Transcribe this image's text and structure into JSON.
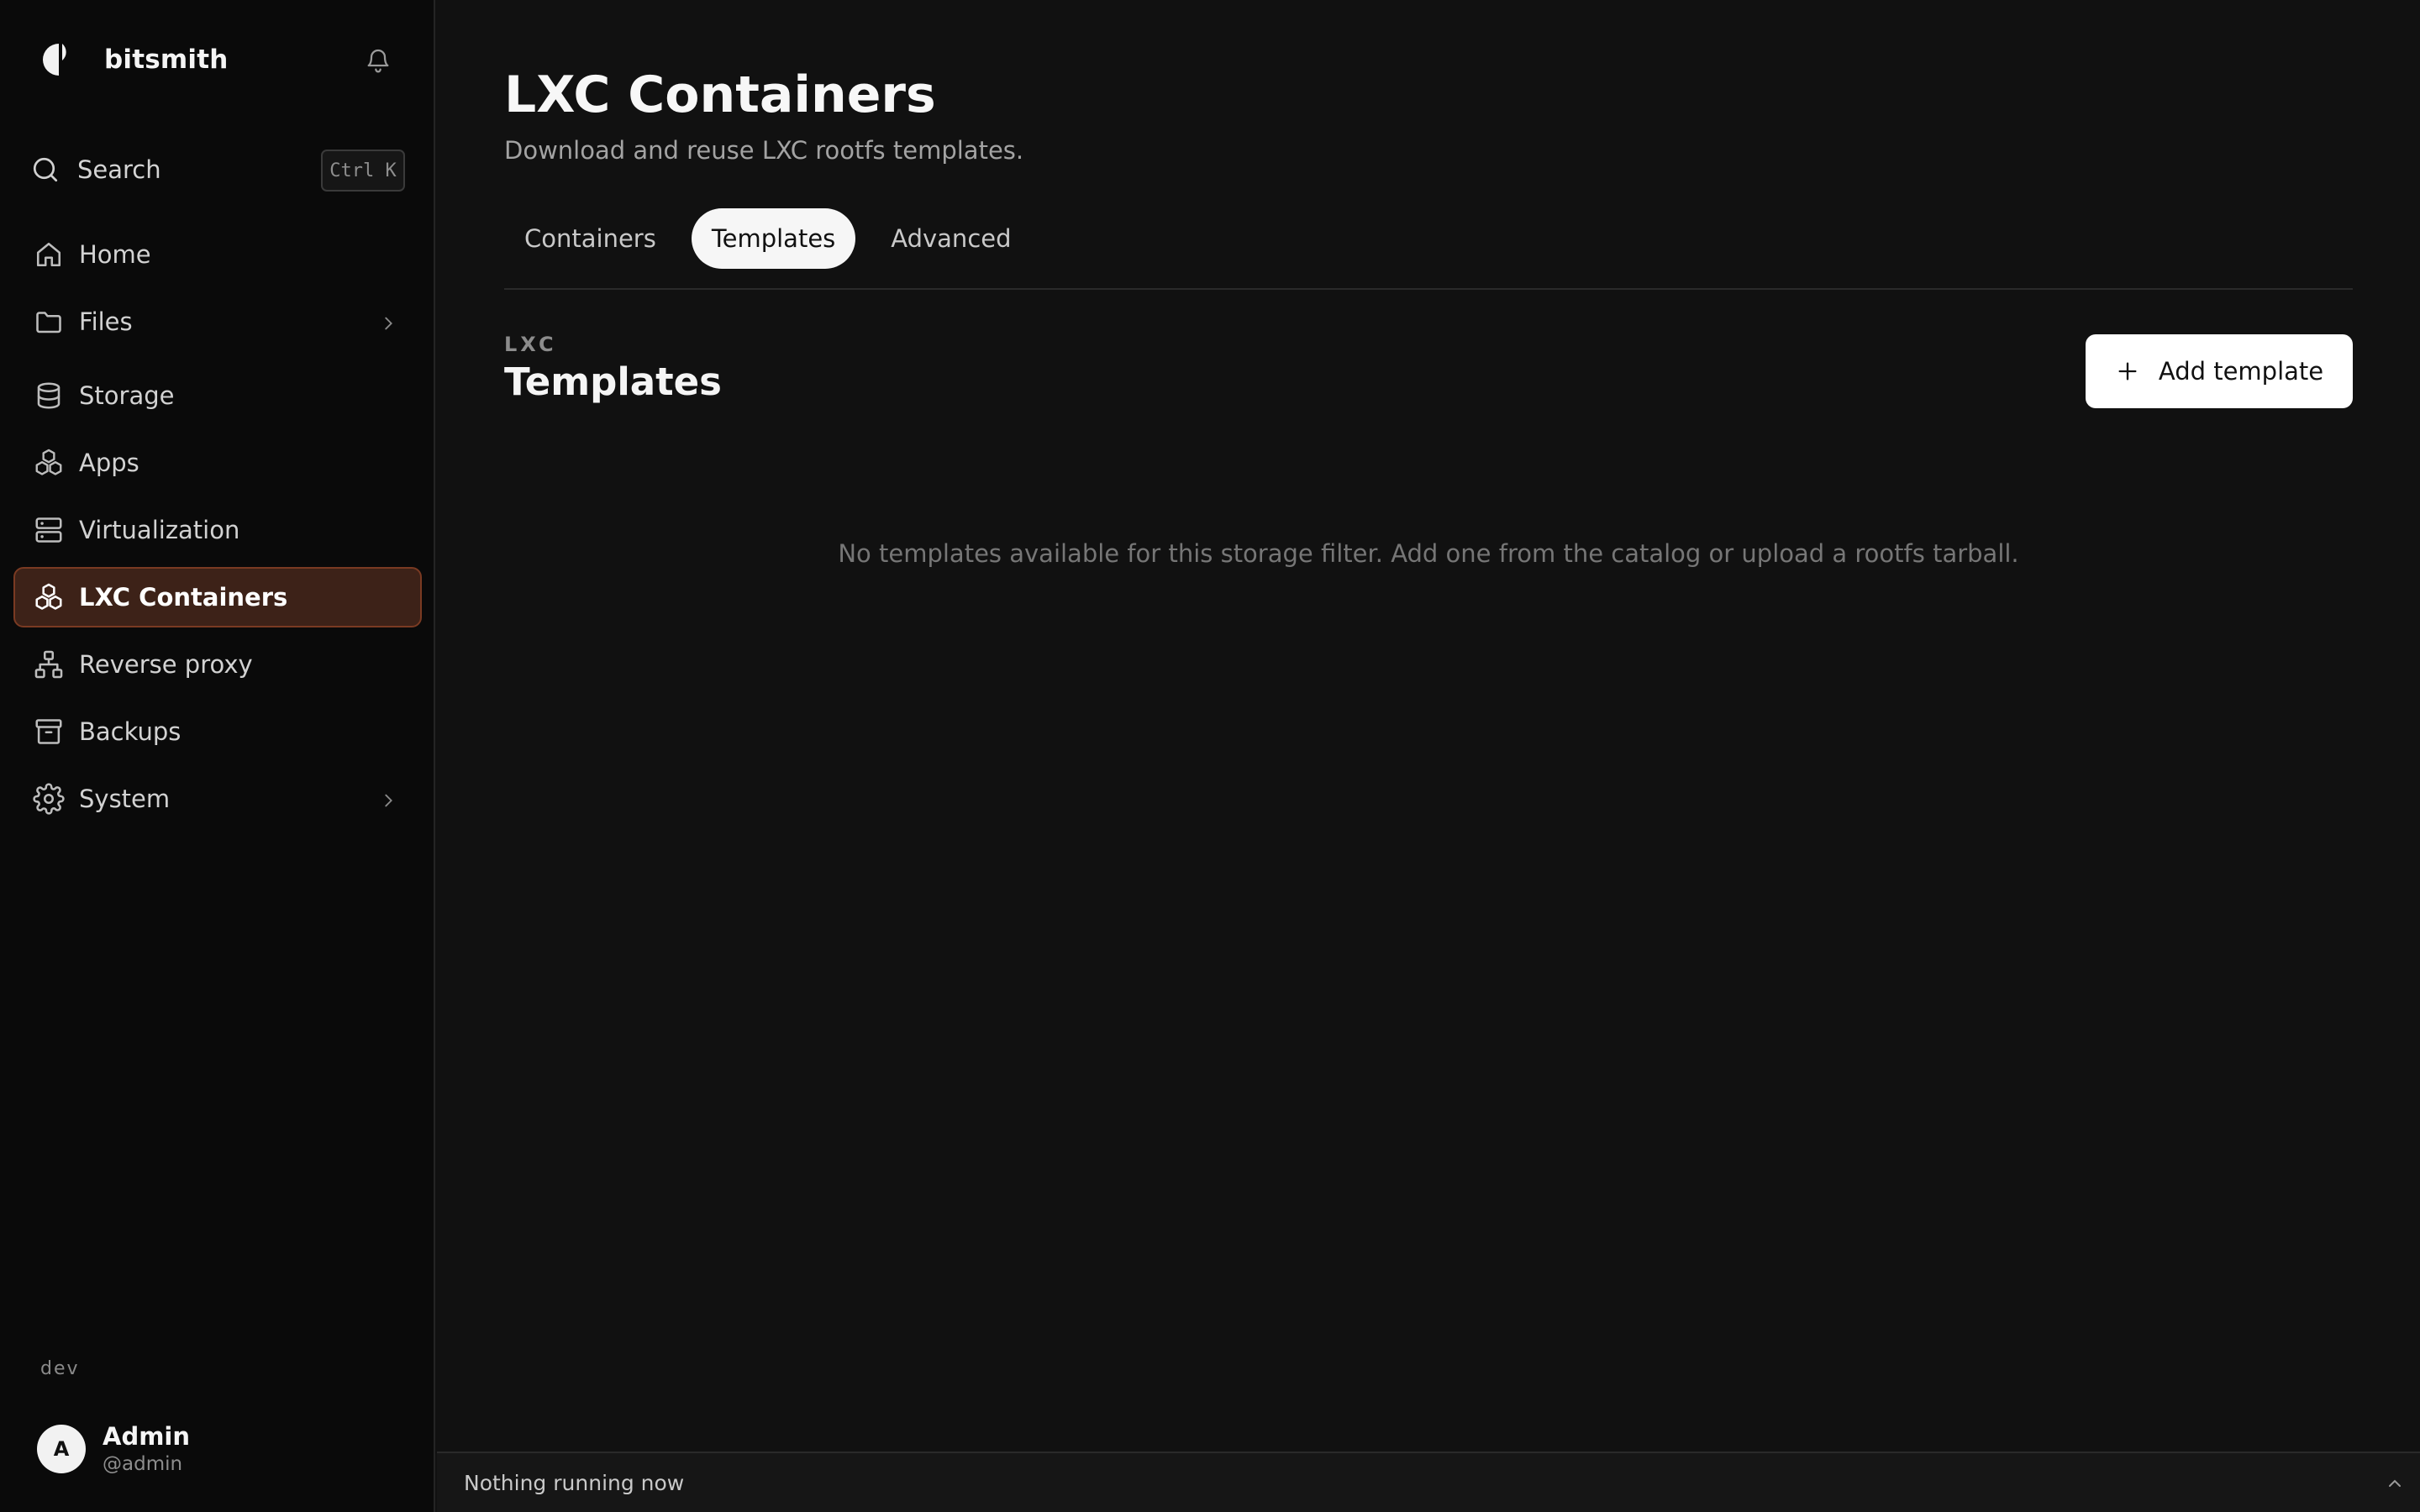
{
  "brand": {
    "name": "bitsmith"
  },
  "search": {
    "label": "Search",
    "shortcut": "Ctrl K"
  },
  "sidebar": {
    "items": [
      {
        "label": "Home",
        "icon": "home-icon"
      },
      {
        "label": "Files",
        "icon": "folder-icon",
        "has_submenu": true
      },
      {
        "label": "Storage",
        "icon": "database-icon"
      },
      {
        "label": "Apps",
        "icon": "boxes-icon"
      },
      {
        "label": "Virtualization",
        "icon": "server-icon"
      },
      {
        "label": "LXC Containers",
        "icon": "boxes-icon",
        "active": true
      },
      {
        "label": "Reverse proxy",
        "icon": "network-icon"
      },
      {
        "label": "Backups",
        "icon": "archive-icon"
      },
      {
        "label": "System",
        "icon": "gear-icon",
        "has_submenu": true
      }
    ],
    "env": "dev"
  },
  "user": {
    "initial": "A",
    "name": "Admin",
    "handle": "@admin"
  },
  "page": {
    "title": "LXC Containers",
    "subtitle": "Download and reuse LXC rootfs templates."
  },
  "tabs": [
    {
      "label": "Containers",
      "active": false
    },
    {
      "label": "Templates",
      "active": true
    },
    {
      "label": "Advanced",
      "active": false
    }
  ],
  "section": {
    "eyebrow": "LXC",
    "title": "Templates",
    "add_label": "Add template",
    "empty_message": "No templates available for this storage filter. Add one from the catalog or upload a rootfs tarball."
  },
  "status_bar": {
    "text": "Nothing running now"
  },
  "colors": {
    "background": "#111111",
    "sidebar": "#0a0a0a",
    "active_item": "#3d2218",
    "active_border": "#7a3a22",
    "button": "#ffffff"
  }
}
